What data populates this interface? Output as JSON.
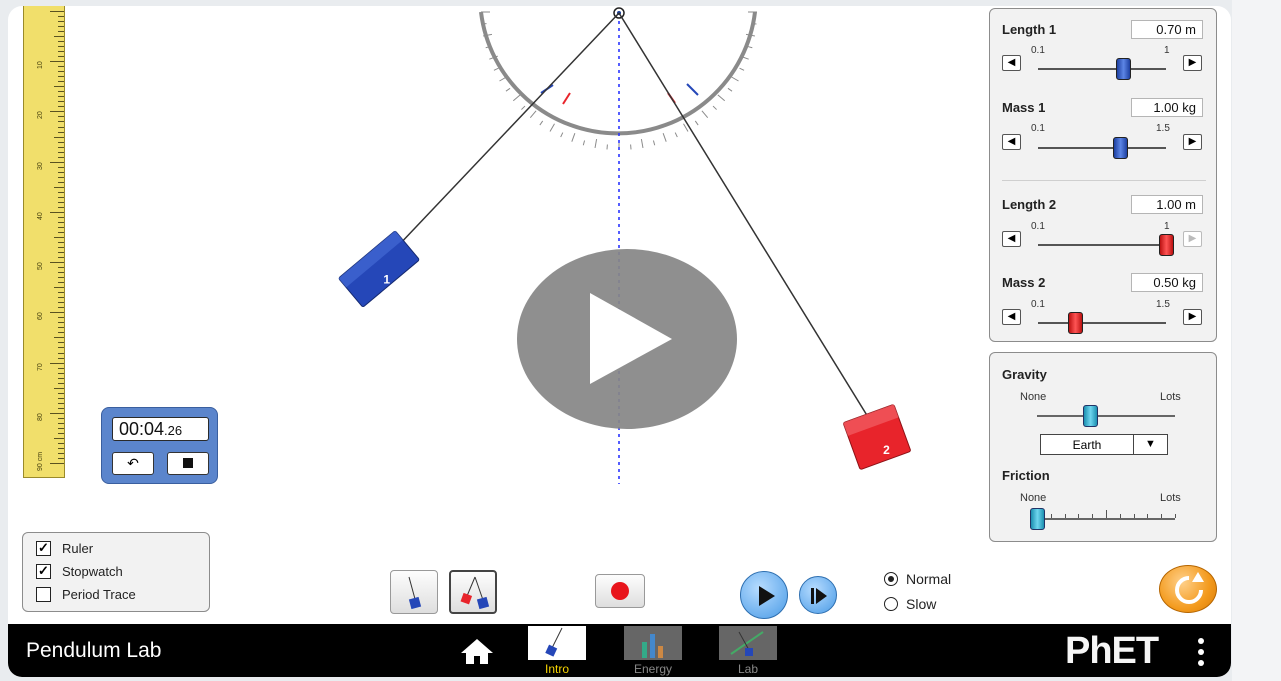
{
  "app": {
    "title": "Pendulum Lab"
  },
  "ruler": {
    "labels": [
      "10",
      "20",
      "30",
      "40",
      "50",
      "60",
      "70",
      "80",
      "90 cm"
    ]
  },
  "protractor": {},
  "pendulums": [
    {
      "label": "1",
      "color": "#2547b8"
    },
    {
      "label": "2",
      "color": "#e8242b"
    }
  ],
  "controls": {
    "length1": {
      "label": "Length 1",
      "value": "0.70 m",
      "min": "0.1",
      "max": "1",
      "fraction": 0.667
    },
    "mass1": {
      "label": "Mass 1",
      "value": "1.00 kg",
      "min": "0.1",
      "max": "1.5",
      "fraction": 0.643
    },
    "length2": {
      "label": "Length 2",
      "value": "1.00 m",
      "min": "0.1",
      "max": "1",
      "fraction": 1.0
    },
    "mass2": {
      "label": "Mass 2",
      "value": "0.50 kg",
      "min": "0.1",
      "max": "1.5",
      "fraction": 0.286
    }
  },
  "environment": {
    "gravity": {
      "label": "Gravity",
      "min_label": "None",
      "max_label": "Lots",
      "selected": "Earth"
    },
    "friction": {
      "label": "Friction",
      "min_label": "None",
      "max_label": "Lots"
    }
  },
  "stopwatch": {
    "time_main": "00:04",
    "time_fraction": ".26"
  },
  "checkboxes": [
    {
      "label": "Ruler",
      "checked": true
    },
    {
      "label": "Stopwatch",
      "checked": true
    },
    {
      "label": "Period Trace",
      "checked": false
    }
  ],
  "speed": {
    "normal_label": "Normal",
    "slow_label": "Slow",
    "selected": "Normal"
  },
  "navbar": {
    "tabs": [
      {
        "label": "Intro",
        "active": true
      },
      {
        "label": "Energy",
        "active": false
      },
      {
        "label": "Lab",
        "active": false
      }
    ],
    "brand": "PhET"
  },
  "colors": {
    "accent_blue": "#2547b8",
    "accent_red": "#e8242b",
    "tab_active": "#f6d400",
    "refresh": "#f39a1d"
  }
}
